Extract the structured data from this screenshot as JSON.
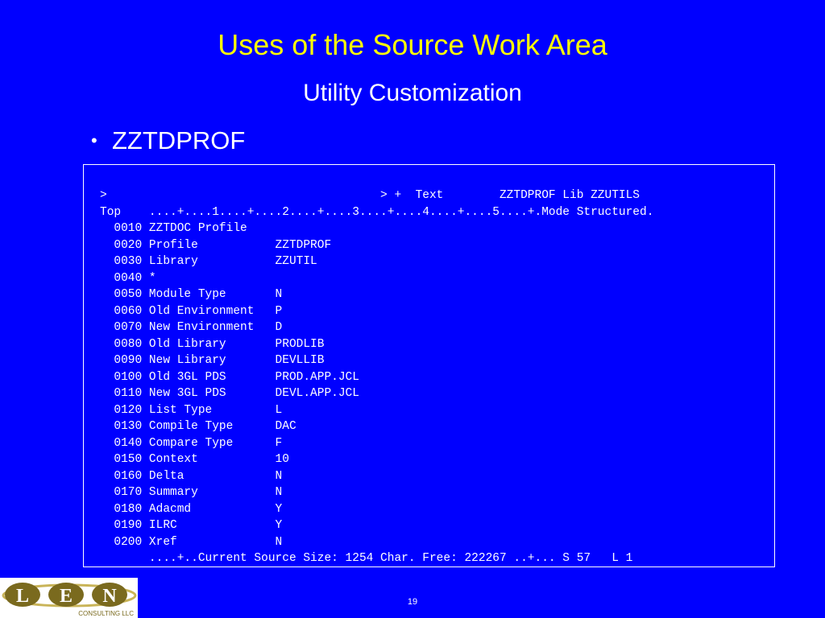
{
  "slide": {
    "title": "Uses of the Source Work Area",
    "subtitle": "Utility Customization",
    "bullet": "ZZTDPROF",
    "page_number": "19"
  },
  "terminal": {
    "lines": [
      ">                                       > +  Text        ZZTDPROF Lib ZZUTILS",
      "Top    ....+....1....+....2....+....3....+....4....+....5....+.Mode Structured.",
      "  0010 ZZTDOC Profile",
      "  0020 Profile           ZZTDPROF",
      "  0030 Library           ZZUTIL",
      "  0040 *",
      "  0050 Module Type       N",
      "  0060 Old Environment   P",
      "  0070 New Environment   D",
      "  0080 Old Library       PRODLIB",
      "  0090 New Library       DEVLLIB",
      "  0100 Old 3GL PDS       PROD.APP.JCL",
      "  0110 New 3GL PDS       DEVL.APP.JCL",
      "  0120 List Type         L",
      "  0130 Compile Type      DAC",
      "  0140 Compare Type      F",
      "  0150 Context           10",
      "  0160 Delta             N",
      "  0170 Summary           N",
      "  0180 Adacmd            Y",
      "  0190 ILRC              Y",
      "  0200 Xref              N",
      "       ....+..Current Source Size: 1254 Char. Free: 222267 ..+... S 57   L 1"
    ]
  },
  "logo": {
    "letters": [
      "L",
      "E",
      "N"
    ],
    "caption": "CONSULTING LLC"
  },
  "colors": {
    "background": "#0000ff",
    "title": "#ffff00",
    "text": "#ffffff",
    "logo_olive": "#7a6a1e",
    "logo_gold": "#c9b458"
  }
}
